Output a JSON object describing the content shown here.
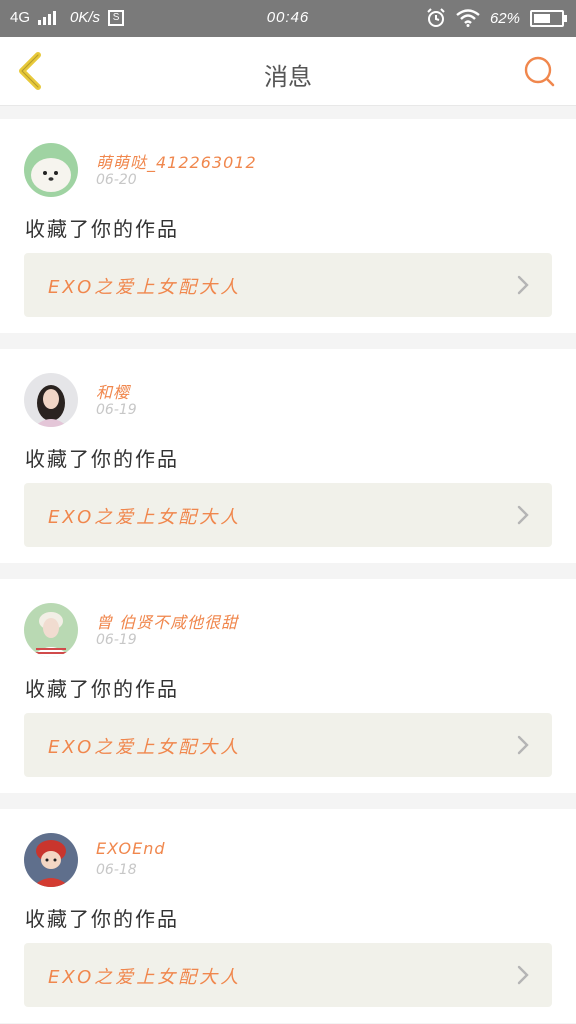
{
  "status_bar": {
    "network": "4G",
    "speed": "0K/s",
    "sim_label": "S",
    "time": "00:46",
    "battery": "62%",
    "battery_level": 0.62
  },
  "header": {
    "title": "消息",
    "back_icon": "chevron-left-icon",
    "search_icon": "search-icon"
  },
  "colors": {
    "accent": "#f0874d",
    "back_icon": "#e8c93a",
    "link_bg": "#f1f1ea"
  },
  "messages": [
    {
      "user": "萌萌哒_412263012",
      "date": "06-20",
      "action": "收藏了你的作品",
      "work": "EXO之爱上女配大人",
      "avatar": "white-puppy"
    },
    {
      "user": "和樱",
      "date": "06-19",
      "action": "收藏了你的作品",
      "work": "EXO之爱上女配大人",
      "avatar": "girl-portrait"
    },
    {
      "user": "曾 伯贤不咸他很甜",
      "date": "06-19",
      "action": "收藏了你的作品",
      "work": "EXO之爱上女配大人",
      "avatar": "boy-portrait"
    },
    {
      "user": "EXOEnd",
      "date": "06-18",
      "action": "收藏了你的作品",
      "work": "EXO之爱上女配大人",
      "avatar": "cartoon-character"
    }
  ]
}
